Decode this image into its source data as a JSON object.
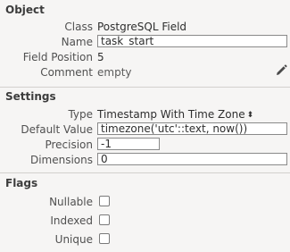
{
  "object": {
    "title": "Object",
    "class_label": "Class",
    "class_value": "PostgreSQL Field",
    "name_label": "Name",
    "name_value": "task_start",
    "position_label": "Field Position",
    "position_value": "5",
    "comment_label": "Comment",
    "comment_value": "empty",
    "edit_icon": "pencil-icon"
  },
  "settings": {
    "title": "Settings",
    "type_label": "Type",
    "type_value": "Timestamp With Time Zone",
    "default_label": "Default Value",
    "default_value": "timezone('utc'::text, now())",
    "precision_label": "Precision",
    "precision_value": "-1",
    "dimensions_label": "Dimensions",
    "dimensions_value": "0"
  },
  "flags": {
    "title": "Flags",
    "nullable_label": "Nullable",
    "indexed_label": "Indexed",
    "unique_label": "Unique"
  }
}
